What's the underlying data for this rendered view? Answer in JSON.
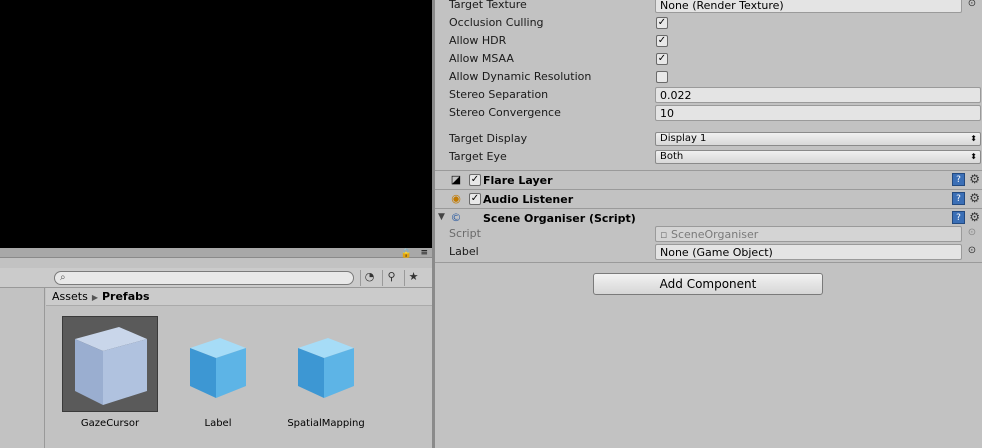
{
  "left": {
    "breadcrumb": {
      "root": "Assets",
      "separator": "▶",
      "current": "Prefabs"
    },
    "assets": [
      {
        "label": "GazeCursor",
        "selected": true
      },
      {
        "label": "Label",
        "selected": false
      },
      {
        "label": "SpatialMapping",
        "selected": false
      }
    ]
  },
  "inspector": {
    "target_texture": {
      "label": "Target Texture",
      "value": "None (Render Texture)"
    },
    "occlusion_culling": {
      "label": "Occlusion Culling",
      "checked": true
    },
    "allow_hdr": {
      "label": "Allow HDR",
      "checked": true
    },
    "allow_msaa": {
      "label": "Allow MSAA",
      "checked": true
    },
    "allow_dynamic_resolution": {
      "label": "Allow Dynamic Resolution",
      "checked": false
    },
    "stereo_separation": {
      "label": "Stereo Separation",
      "value": "0.022"
    },
    "stereo_convergence": {
      "label": "Stereo Convergence",
      "value": "10"
    },
    "target_display": {
      "label": "Target Display",
      "value": "Display 1"
    },
    "target_eye": {
      "label": "Target Eye",
      "value": "Both"
    },
    "flare_layer": {
      "title": "Flare Layer"
    },
    "audio_listener": {
      "title": "Audio Listener"
    },
    "scene_organiser": {
      "title": "Scene Organiser (Script)",
      "script": {
        "label": "Script",
        "value": "SceneOrganiser"
      },
      "label_field": {
        "label": "Label",
        "value": "None (Game Object)"
      }
    },
    "add_component": "Add Component",
    "help_glyph": "?",
    "gear_glyph": "⚙",
    "check_glyph": "✓"
  }
}
